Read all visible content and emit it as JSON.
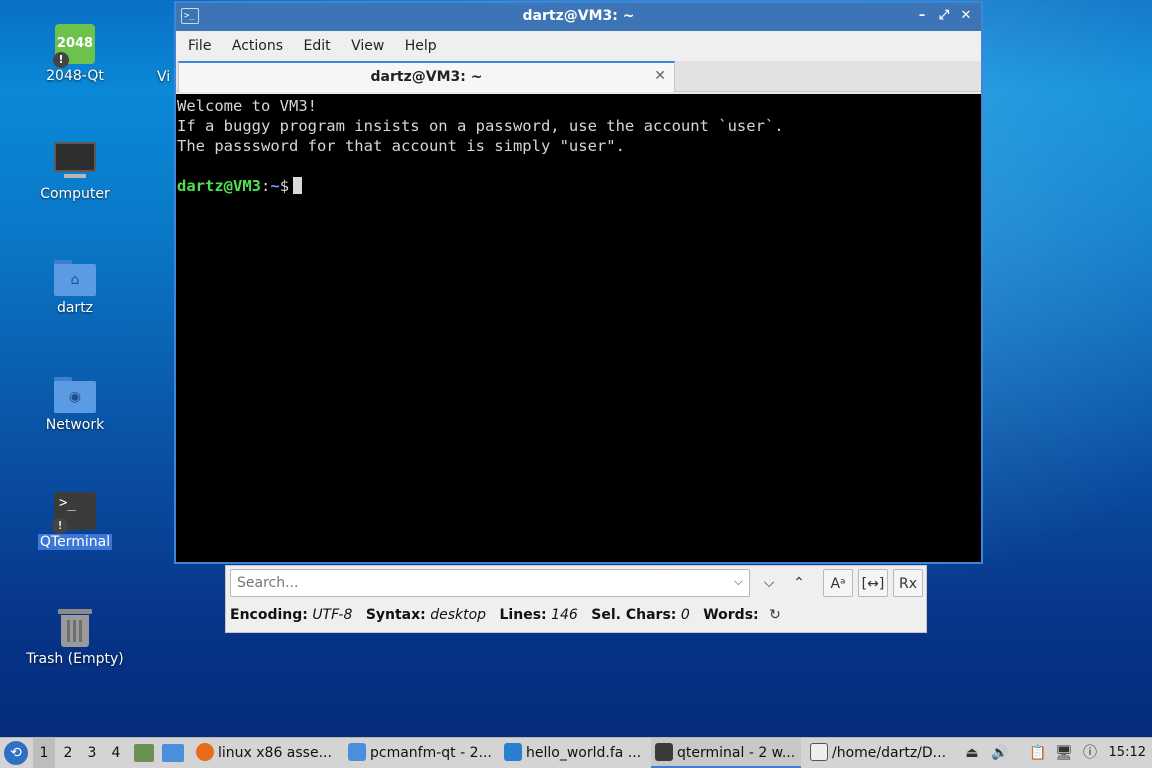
{
  "desktop": {
    "icons": [
      {
        "label": "2048-Qt",
        "glyph": "2048",
        "icon": "game-2048-icon",
        "badge": "!"
      },
      {
        "label": "Computer",
        "icon": "computer-icon"
      },
      {
        "label": "dartz",
        "glyph": "⌂",
        "icon": "home-folder-icon"
      },
      {
        "label": "Network",
        "glyph": "◉",
        "icon": "network-folder-icon"
      },
      {
        "label": "QTerminal",
        "glyph": ">_",
        "icon": "terminal-icon",
        "badge": "!"
      },
      {
        "label": "Trash (Empty)",
        "icon": "trash-icon"
      }
    ],
    "partial_label": "Vi"
  },
  "window": {
    "title": "dartz@VM3: ~",
    "title_icon": ">_",
    "controls": {
      "minimize": "–",
      "maximize": "⤢",
      "close": "✕"
    },
    "menu": [
      "File",
      "Actions",
      "Edit",
      "View",
      "Help"
    ],
    "tab": {
      "label": "dartz@VM3: ~",
      "close": "✕"
    },
    "terminal": {
      "lines": [
        "Welcome to VM3!",
        "If a buggy program insists on a password, use the account `user`.",
        "The passsword for that account is simply \"user\".",
        ""
      ],
      "prompt_user": "dartz@VM3",
      "prompt_sep": ":",
      "prompt_path": "~",
      "prompt_symbol": "$"
    }
  },
  "findbar": {
    "search_placeholder": "Search...",
    "dropdown": "⌵",
    "next": "⌵",
    "prev": "⌃",
    "match_case": "Aᵃ",
    "whole_word": "[↔]",
    "regex": "Rx",
    "status": {
      "encoding_label": "Encoding:",
      "encoding_value": "UTF-8",
      "syntax_label": "Syntax:",
      "syntax_value": "desktop",
      "lines_label": "Lines:",
      "lines_value": "146",
      "selchars_label": "Sel. Chars:",
      "selchars_value": "0",
      "words_label": "Words:",
      "refresh": "↻"
    }
  },
  "taskbar": {
    "start": "⟲",
    "workspaces": [
      "1",
      "2",
      "3",
      "4"
    ],
    "tasks": [
      {
        "label": "linux x86 asse...",
        "color": "#e86a1c",
        "icon": "firefox-icon"
      },
      {
        "label": "pcmanfm-qt - 2...",
        "color": "#4a8fdc",
        "icon": "folder-icon"
      },
      {
        "label": "hello_world.fa ...",
        "color": "#2a7fd0",
        "icon": "vscode-icon"
      },
      {
        "label": "qterminal - 2 w...",
        "color": "#3b3b3b",
        "icon": "terminal-icon"
      },
      {
        "label": "/home/dartz/D...",
        "color": "#555555",
        "icon": "editor-icon"
      }
    ],
    "tray": [
      "⏏",
      "🔊",
      "📋",
      "🖥",
      "ⓘ"
    ],
    "clock": "15:12"
  }
}
